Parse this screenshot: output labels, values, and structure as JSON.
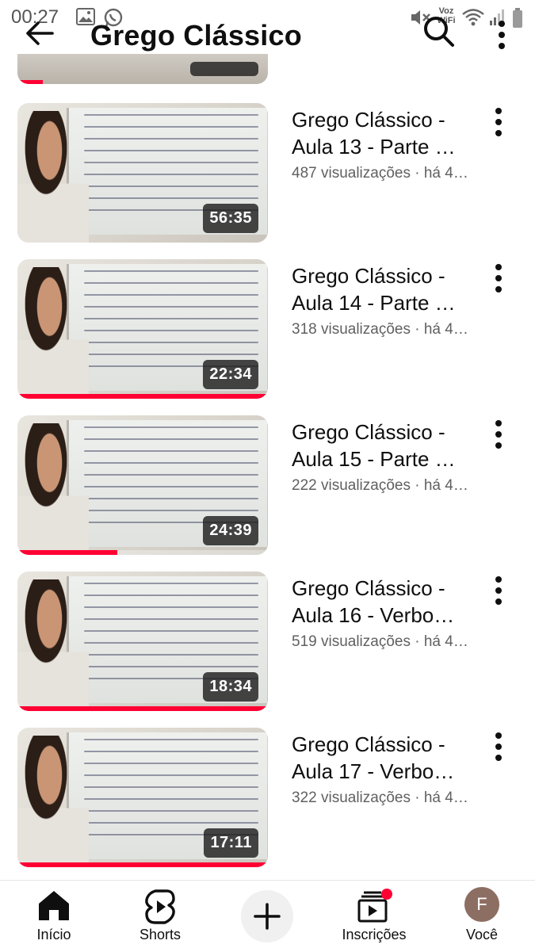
{
  "status_bar": {
    "time": "00:27",
    "icons": [
      "image-icon",
      "whatsapp-icon",
      "mute-icon",
      "vowifi-icon",
      "wifi-icon",
      "signal-icon",
      "battery-icon"
    ],
    "vowifi_label_top": "Voz",
    "vowifi_label_bottom": "WiFi"
  },
  "header": {
    "title": "Grego Clássico",
    "back_icon": "arrow-left-icon",
    "search_icon": "search-icon",
    "more_icon": "more-vert-icon"
  },
  "videos": [
    {
      "title_line1": "Grego Clássico -",
      "title_line2": "Aula 13 - Parte …",
      "meta": "487 visualizações · há 4…",
      "duration": "56:35",
      "watched_fraction": 0.0
    },
    {
      "title_line1": "Grego Clássico -",
      "title_line2": "Aula 14 - Parte …",
      "meta": "318 visualizações · há 4…",
      "duration": "22:34",
      "watched_fraction": 1.0
    },
    {
      "title_line1": "Grego Clássico -",
      "title_line2": "Aula 15 - Parte …",
      "meta": "222 visualizações · há 4…",
      "duration": "24:39",
      "watched_fraction": 0.4
    },
    {
      "title_line1": "Grego Clássico -",
      "title_line2": "Aula 16 - Verbo…",
      "meta": "519 visualizações · há 4…",
      "duration": "18:34",
      "watched_fraction": 1.0
    },
    {
      "title_line1": "Grego Clássico -",
      "title_line2": "Aula 17 - Verbo…",
      "meta": "322 visualizações · há 4…",
      "duration": "17:11",
      "watched_fraction": 1.0
    }
  ],
  "bottom_nav": {
    "home_label": "Início",
    "shorts_label": "Shorts",
    "subscriptions_label": "Inscrições",
    "you_label": "Você",
    "avatar_initial": "F"
  },
  "colors": {
    "accent": "#ff0033",
    "text_primary": "#0f0f0f",
    "text_secondary": "#606060",
    "avatar_bg": "#8d6e63"
  }
}
